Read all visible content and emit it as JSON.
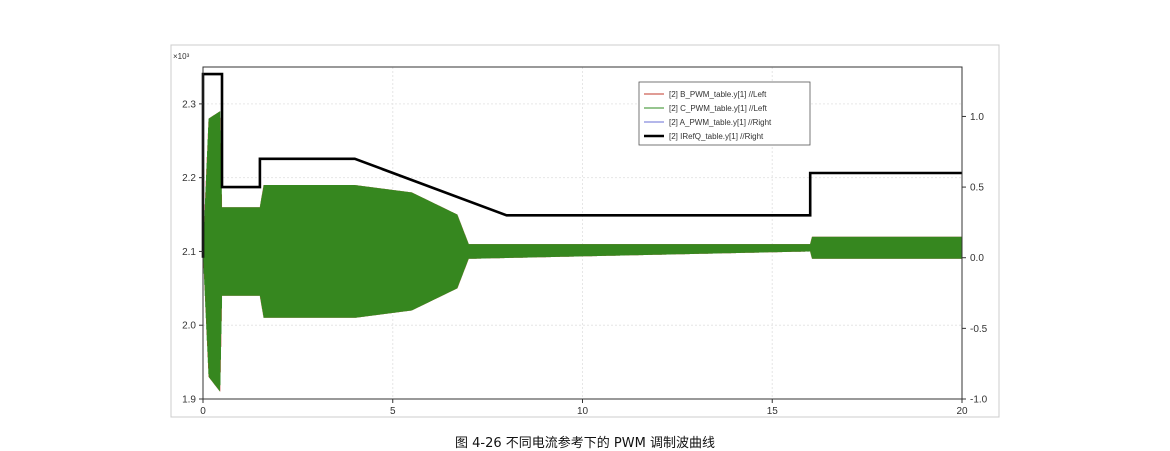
{
  "chart_data": {
    "type": "line",
    "x_axis": {
      "range": [
        0,
        20
      ],
      "ticks": [
        0,
        5,
        10,
        15,
        20
      ]
    },
    "y_left": {
      "range": [
        1.9,
        2.35
      ],
      "ticks": [
        1.9,
        2.0,
        2.1,
        2.2,
        2.3
      ],
      "tick_labels": [
        "1.9",
        "2.0",
        "2.1",
        "2.2",
        "2.3"
      ],
      "multiplier": "×10³"
    },
    "y_right": {
      "range": [
        -1.0,
        1.35
      ],
      "ticks": [
        -1.0,
        -0.5,
        0.0,
        0.5,
        1.0
      ],
      "tick_labels": [
        "-1.0",
        "-0.5",
        "0.0",
        "0.5",
        "1.0"
      ]
    },
    "grid": true,
    "legend_position": "top-right",
    "series": [
      {
        "name": "[2] B_PWM_table.y[1] //Left",
        "color": "#c0392b",
        "axis": "left",
        "style": "oscillating",
        "envelope": [
          [
            0.0,
            2.1,
            2.1
          ],
          [
            0.15,
            1.93,
            2.28
          ],
          [
            0.45,
            1.91,
            2.29
          ],
          [
            0.5,
            2.04,
            2.16
          ],
          [
            1.5,
            2.04,
            2.16
          ],
          [
            1.6,
            2.01,
            2.19
          ],
          [
            4.0,
            2.01,
            2.19
          ],
          [
            5.5,
            2.02,
            2.18
          ],
          [
            6.7,
            2.05,
            2.15
          ],
          [
            7.0,
            2.09,
            2.11
          ],
          [
            16.0,
            2.1,
            2.11
          ],
          [
            16.05,
            2.09,
            2.12
          ],
          [
            20.0,
            2.09,
            2.12
          ]
        ]
      },
      {
        "name": "[2] C_PWM_table.y[1] //Left",
        "color": "#2e8b1f",
        "axis": "left",
        "style": "oscillating",
        "envelope": [
          [
            0.0,
            2.1,
            2.1
          ],
          [
            0.15,
            1.93,
            2.28
          ],
          [
            0.45,
            1.91,
            2.29
          ],
          [
            0.5,
            2.04,
            2.16
          ],
          [
            1.5,
            2.04,
            2.16
          ],
          [
            1.6,
            2.01,
            2.19
          ],
          [
            4.0,
            2.01,
            2.19
          ],
          [
            5.5,
            2.02,
            2.18
          ],
          [
            6.7,
            2.05,
            2.15
          ],
          [
            7.0,
            2.09,
            2.11
          ],
          [
            16.0,
            2.1,
            2.11
          ],
          [
            16.05,
            2.09,
            2.12
          ],
          [
            20.0,
            2.09,
            2.12
          ]
        ]
      },
      {
        "name": "[2] A_PWM_table.y[1] //Right",
        "color": "#6a6fd6",
        "axis": "right",
        "style": "line",
        "points": []
      },
      {
        "name": "[2] IRefQ_table.y[1] //Right",
        "color": "#000000",
        "axis": "right",
        "style": "step",
        "points": [
          [
            0.0,
            0.0
          ],
          [
            0.0,
            1.3
          ],
          [
            0.5,
            1.3
          ],
          [
            0.5,
            0.5
          ],
          [
            1.5,
            0.5
          ],
          [
            1.5,
            0.7
          ],
          [
            4.0,
            0.7
          ],
          [
            8.0,
            0.3
          ],
          [
            16.0,
            0.3
          ],
          [
            16.0,
            0.6
          ],
          [
            20.0,
            0.6
          ]
        ]
      }
    ]
  },
  "caption": "图 4-26 不同电流参考下的 PWM 调制波曲线"
}
